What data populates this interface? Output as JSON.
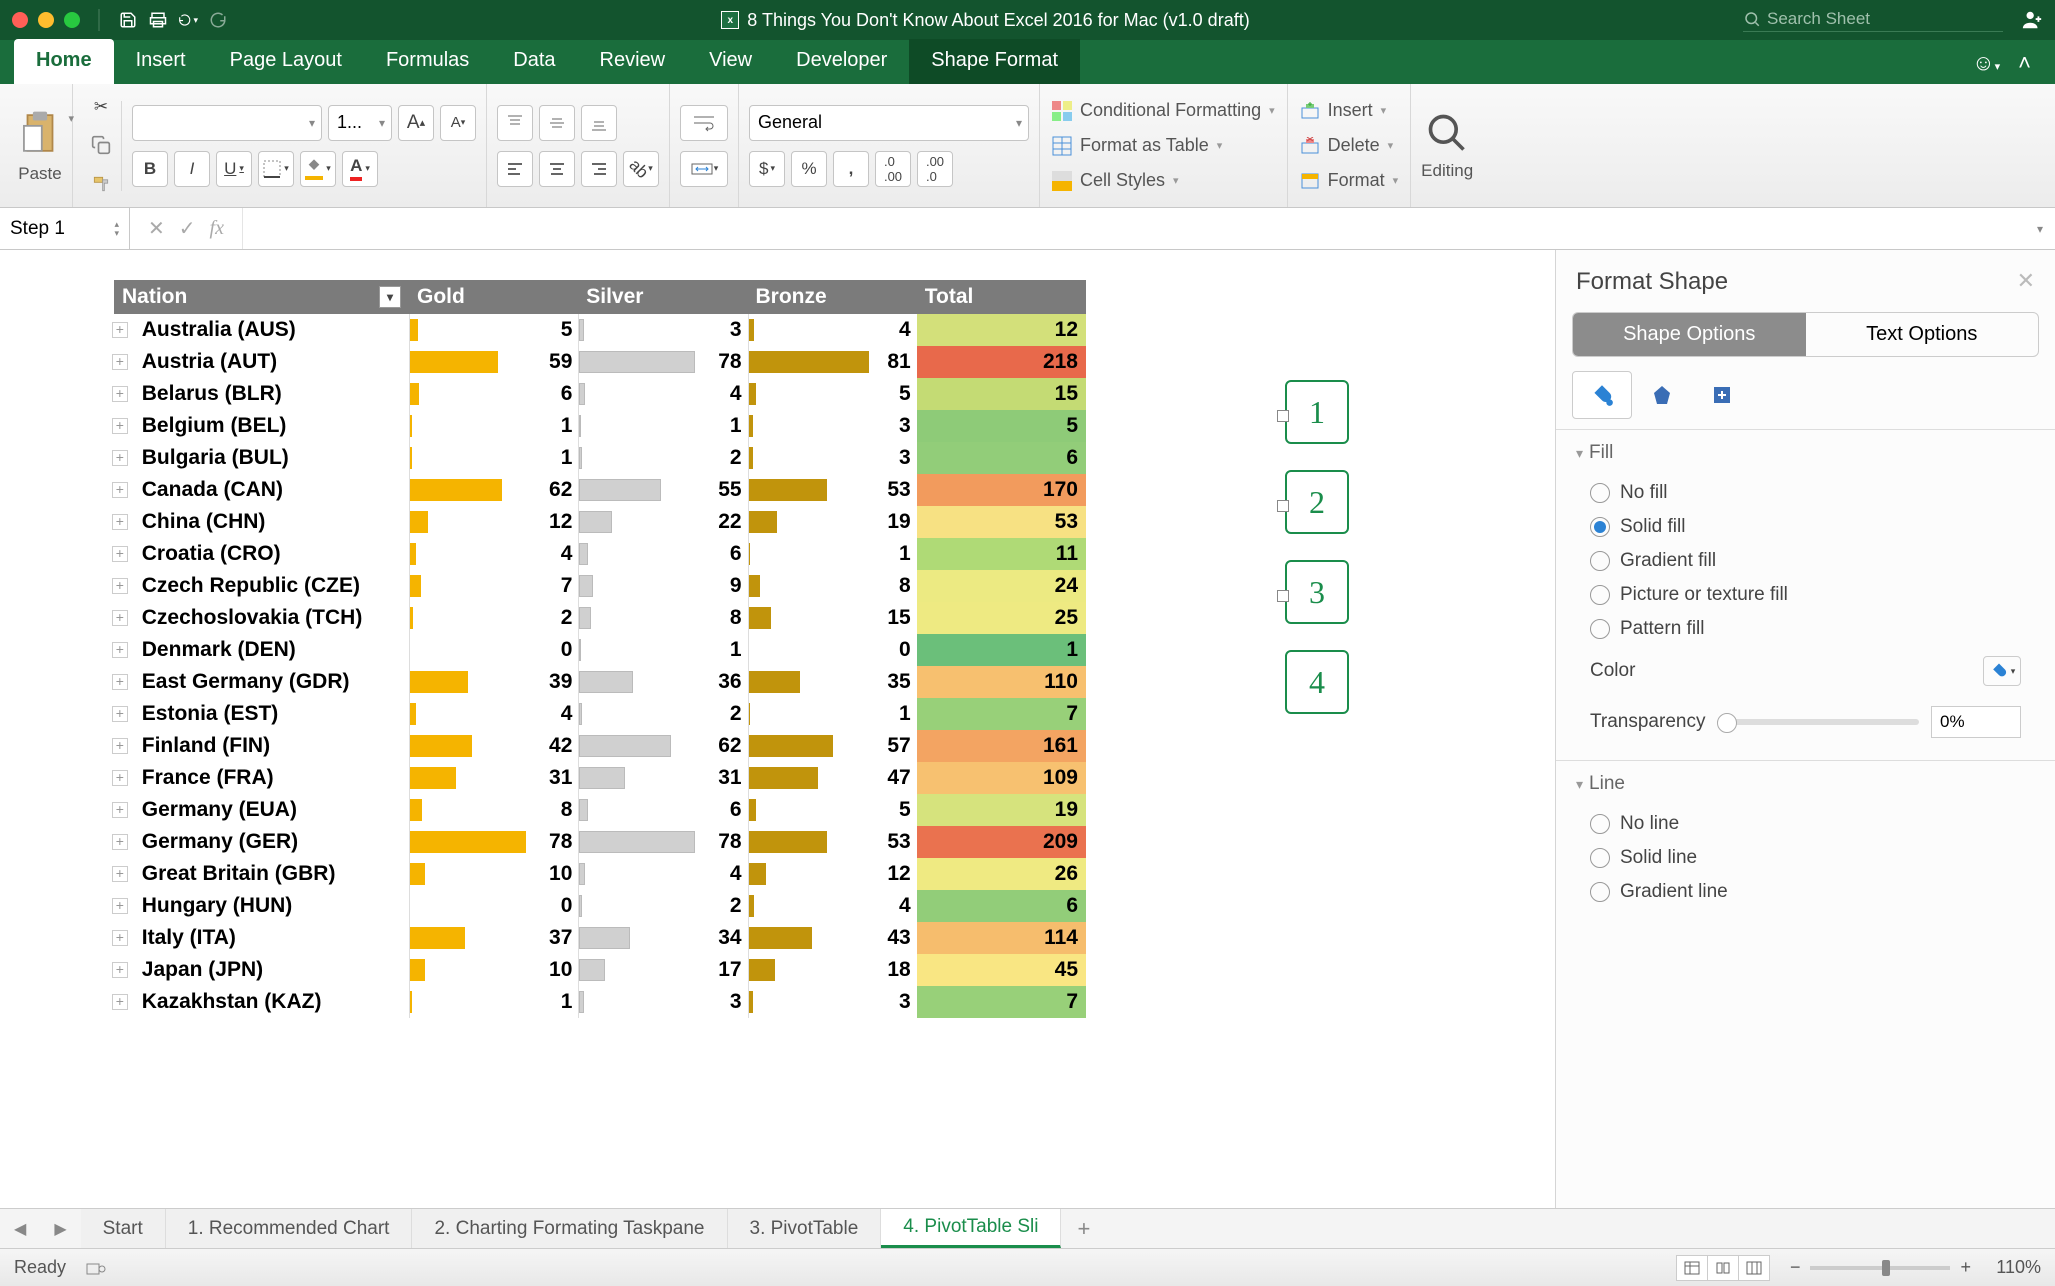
{
  "window": {
    "title": "8 Things You Don't Know About Excel 2016 for Mac (v1.0 draft)",
    "search_placeholder": "Search Sheet"
  },
  "tabs": {
    "items": [
      "Home",
      "Insert",
      "Page Layout",
      "Formulas",
      "Data",
      "Review",
      "View",
      "Developer",
      "Shape Format"
    ],
    "active": "Home",
    "contextual": "Shape Format"
  },
  "ribbon": {
    "paste": "Paste",
    "font_size": "1...",
    "number_format": "General",
    "cond_fmt": "Conditional Formatting",
    "fmt_table": "Format as Table",
    "cell_styles": "Cell Styles",
    "insert": "Insert",
    "delete": "Delete",
    "format": "Format",
    "editing": "Editing"
  },
  "formula_bar": {
    "name": "Step 1"
  },
  "pivot": {
    "headers": [
      "Nation",
      "Gold",
      "Silver",
      "Bronze",
      "Total"
    ],
    "rows": [
      {
        "nation": "Australia (AUS)",
        "g": 5,
        "s": 3,
        "b": 4,
        "t": 12,
        "tc": "#d3e07a"
      },
      {
        "nation": "Austria (AUT)",
        "g": 59,
        "s": 78,
        "b": 81,
        "t": 218,
        "tc": "#e8694b"
      },
      {
        "nation": "Belarus (BLR)",
        "g": 6,
        "s": 4,
        "b": 5,
        "t": 15,
        "tc": "#c4db74"
      },
      {
        "nation": "Belgium (BEL)",
        "g": 1,
        "s": 1,
        "b": 3,
        "t": 5,
        "tc": "#8ecb78"
      },
      {
        "nation": "Bulgaria (BUL)",
        "g": 1,
        "s": 2,
        "b": 3,
        "t": 6,
        "tc": "#92cd79"
      },
      {
        "nation": "Canada (CAN)",
        "g": 62,
        "s": 55,
        "b": 53,
        "t": 170,
        "tc": "#f29b5d"
      },
      {
        "nation": "China (CHN)",
        "g": 12,
        "s": 22,
        "b": 19,
        "t": 53,
        "tc": "#f7e183"
      },
      {
        "nation": "Croatia (CRO)",
        "g": 4,
        "s": 6,
        "b": 1,
        "t": 11,
        "tc": "#afda76"
      },
      {
        "nation": "Czech Republic (CZE)",
        "g": 7,
        "s": 9,
        "b": 8,
        "t": 24,
        "tc": "#ecea82"
      },
      {
        "nation": "Czechoslovakia (TCH)",
        "g": 2,
        "s": 8,
        "b": 15,
        "t": 25,
        "tc": "#eeea82"
      },
      {
        "nation": "Denmark (DEN)",
        "g": 0,
        "s": 1,
        "b": 0,
        "t": 1,
        "tc": "#6bbf7a"
      },
      {
        "nation": "East Germany (GDR)",
        "g": 39,
        "s": 36,
        "b": 35,
        "t": 110,
        "tc": "#f7c06f"
      },
      {
        "nation": "Estonia (EST)",
        "g": 4,
        "s": 2,
        "b": 1,
        "t": 7,
        "tc": "#98d079"
      },
      {
        "nation": "Finland (FIN)",
        "g": 42,
        "s": 62,
        "b": 57,
        "t": 161,
        "tc": "#f3a462"
      },
      {
        "nation": "France (FRA)",
        "g": 31,
        "s": 31,
        "b": 47,
        "t": 109,
        "tc": "#f7c170"
      },
      {
        "nation": "Germany (EUA)",
        "g": 8,
        "s": 6,
        "b": 5,
        "t": 19,
        "tc": "#d6e37d"
      },
      {
        "nation": "Germany (GER)",
        "g": 78,
        "s": 78,
        "b": 53,
        "t": 209,
        "tc": "#ea724f"
      },
      {
        "nation": "Great Britain (GBR)",
        "g": 10,
        "s": 4,
        "b": 12,
        "t": 26,
        "tc": "#efea82"
      },
      {
        "nation": "Hungary (HUN)",
        "g": 0,
        "s": 2,
        "b": 4,
        "t": 6,
        "tc": "#92cd79"
      },
      {
        "nation": "Italy (ITA)",
        "g": 37,
        "s": 34,
        "b": 43,
        "t": 114,
        "tc": "#f6bd6d"
      },
      {
        "nation": "Japan (JPN)",
        "g": 10,
        "s": 17,
        "b": 18,
        "t": 45,
        "tc": "#f9e683"
      },
      {
        "nation": "Kazakhstan (KAZ)",
        "g": 1,
        "s": 3,
        "b": 3,
        "t": 7,
        "tc": "#98d079"
      }
    ],
    "max": 81
  },
  "shapes": {
    "labels": [
      "1",
      "2",
      "3",
      "4"
    ]
  },
  "sidepane": {
    "title": "Format Shape",
    "tab1": "Shape Options",
    "tab2": "Text Options",
    "fill": {
      "title": "Fill",
      "options": [
        "No fill",
        "Solid fill",
        "Gradient fill",
        "Picture or texture fill",
        "Pattern fill"
      ],
      "selected": 1,
      "color_label": "Color",
      "transp_label": "Transparency",
      "transp_value": "0%"
    },
    "line": {
      "title": "Line",
      "options": [
        "No line",
        "Solid line",
        "Gradient line"
      ]
    }
  },
  "sheet_tabs": {
    "items": [
      "Start",
      "1. Recommended Chart",
      "2. Charting Formating Taskpane",
      "3. PivotTable",
      "4. PivotTable Sli"
    ],
    "active": 4
  },
  "statusbar": {
    "ready": "Ready",
    "zoom": "110%"
  }
}
